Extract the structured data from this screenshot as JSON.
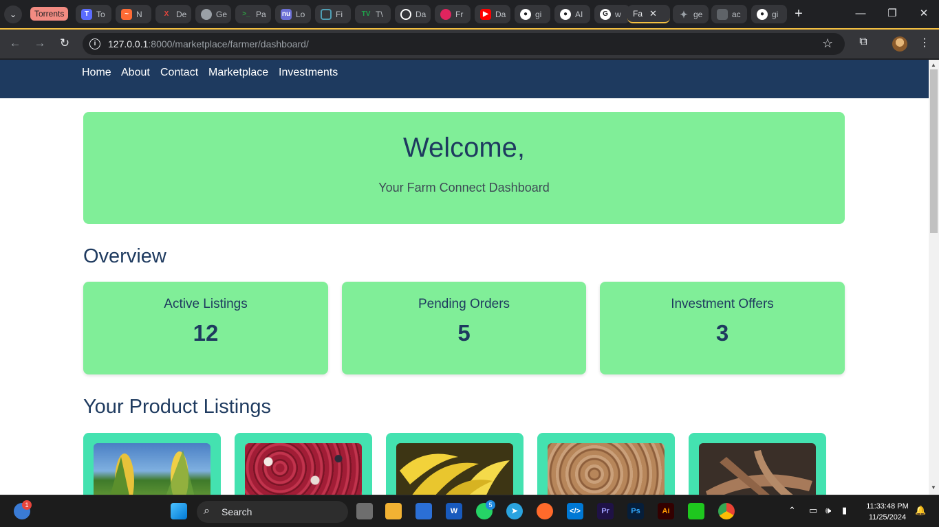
{
  "browser": {
    "tab_group_label": "Torrents",
    "tabs": [
      {
        "title": "To",
        "icon": "t-logo-icon",
        "color": "#5b6cff"
      },
      {
        "title": "N",
        "icon": "chart-logo-icon",
        "color": "#ff6b35"
      },
      {
        "title": "De",
        "icon": "x-logo-icon",
        "color": "#e8453c"
      },
      {
        "title": "Ge",
        "icon": "globe-icon",
        "color": "#9aa0a6"
      },
      {
        "title": "Pa",
        "icon": "terminal-icon",
        "color": "#2ea043"
      },
      {
        "title": "Lo",
        "icon": "nu-logo-icon",
        "color": "#6b6fd6"
      },
      {
        "title": "Fi",
        "icon": "frame-icon",
        "color": "#4f9fb5"
      },
      {
        "title": "T\\",
        "icon": "tv-logo-icon",
        "color": "#1fa34a"
      },
      {
        "title": "Da",
        "icon": "openai-icon",
        "color": "#ffffff"
      },
      {
        "title": "Fr",
        "icon": "fr-logo-icon",
        "color": "#e0245e"
      },
      {
        "title": "Da",
        "icon": "youtube-icon",
        "color": "#ff0000"
      },
      {
        "title": "gi",
        "icon": "github-icon",
        "color": "#ffffff"
      },
      {
        "title": "AI",
        "icon": "github-icon",
        "color": "#ffffff"
      },
      {
        "title": "w",
        "icon": "google-icon",
        "color": "#ffffff"
      },
      {
        "title": "Fa",
        "icon": "page-icon",
        "color": "#9aa0a6",
        "active": true
      },
      {
        "title": "ge",
        "icon": "sparkle-icon",
        "color": "#9aa0a6"
      },
      {
        "title": "ac",
        "icon": "doc-icon",
        "color": "#9aa0a6"
      },
      {
        "title": "gi",
        "icon": "github-icon",
        "color": "#ffffff"
      }
    ],
    "url_host": "127.0.0.1",
    "url_rest": ":8000/marketplace/farmer/dashboard/"
  },
  "site": {
    "nav": [
      "Home",
      "About",
      "Contact",
      "Marketplace",
      "Investments"
    ],
    "hero_title": "Welcome,",
    "hero_subtitle": "Your Farm Connect Dashboard",
    "overview_title": "Overview",
    "stats": [
      {
        "label": "Active Listings",
        "value": "12"
      },
      {
        "label": "Pending Orders",
        "value": "5"
      },
      {
        "label": "Investment Offers",
        "value": "3"
      }
    ],
    "listings_title": "Your Product Listings",
    "products": [
      {
        "image": "corn-photo"
      },
      {
        "image": "kidney-beans-photo"
      },
      {
        "image": "bananas-photo"
      },
      {
        "image": "peanuts-photo"
      },
      {
        "image": "cassava-photo"
      }
    ]
  },
  "taskbar": {
    "search_label": "Search",
    "time": "11:33:48 PM",
    "date": "11/25/2024",
    "weather_badge": "1",
    "whatsapp_badge": "5"
  }
}
